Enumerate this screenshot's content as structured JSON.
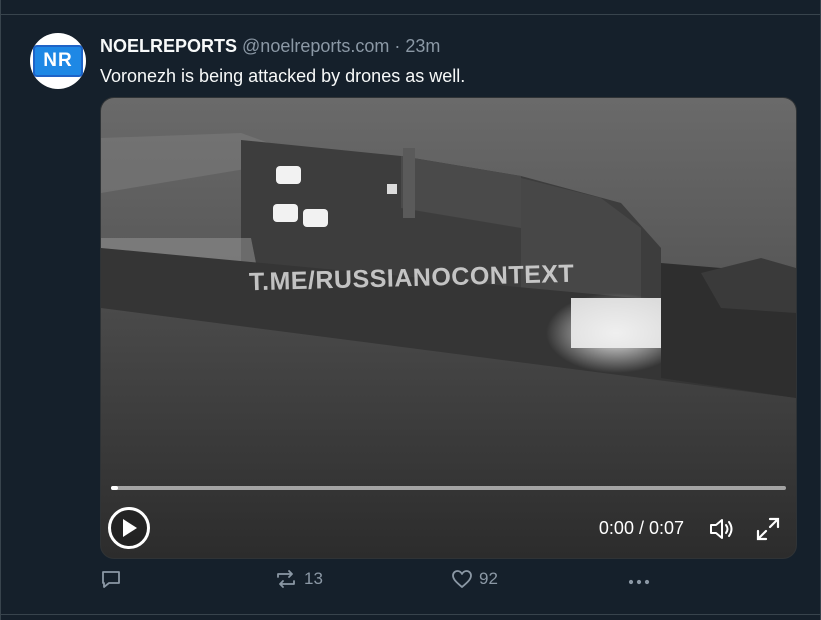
{
  "tweet": {
    "author": {
      "name": "NOELREPORTS",
      "handle": "@noelreports.com",
      "separator": "·",
      "timestamp": "23m",
      "avatar_text": "NR"
    },
    "text": "Voronezh is being attacked by drones as well."
  },
  "media": {
    "type": "video",
    "watermark": "T.ME/RUSSIANOCONTEXT",
    "current_time": "0:00",
    "duration": "0:07",
    "time_display": "0:00 / 0:07",
    "progress_fraction": 0.01,
    "controls": {
      "play_icon": "play-icon",
      "volume_icon": "volume-icon",
      "fullscreen_icon": "fullscreen-icon"
    }
  },
  "actions": {
    "reply_icon": "reply-icon",
    "repost_icon": "repost-icon",
    "repost_count": "13",
    "like_icon": "heart-icon",
    "like_count": "92",
    "more_icon": "more-icon"
  },
  "colors": {
    "background": "#15202b",
    "divider": "#38444d",
    "muted_text": "#8b98a5",
    "primary_text": "#f7f9f9"
  }
}
